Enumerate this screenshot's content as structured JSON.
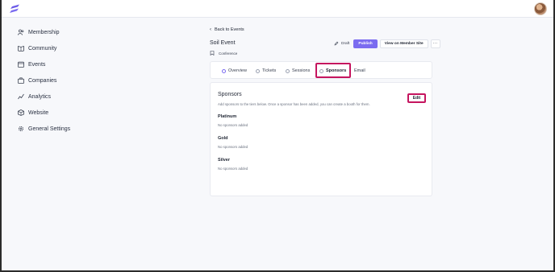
{
  "sidebar": {
    "items": [
      {
        "label": "Membership",
        "icon": "users-icon"
      },
      {
        "label": "Community",
        "icon": "book-icon"
      },
      {
        "label": "Events",
        "icon": "calendar-icon"
      },
      {
        "label": "Companies",
        "icon": "briefcase-icon"
      },
      {
        "label": "Analytics",
        "icon": "chart-line-icon"
      },
      {
        "label": "Website",
        "icon": "cube-icon"
      },
      {
        "label": "General Settings",
        "icon": "gear-icon"
      }
    ]
  },
  "header": {
    "back_label": "Back to Events",
    "event_title": "Soil Event",
    "event_type": "Conference",
    "status": "Draft",
    "publish_label": "Publish",
    "view_label": "View on Member Site",
    "more_label": "···"
  },
  "tabs": [
    {
      "label": "Overview"
    },
    {
      "label": "Tickets"
    },
    {
      "label": "Sessions"
    },
    {
      "label": "Sponsors"
    },
    {
      "label": "Email"
    }
  ],
  "sponsors": {
    "title": "Sponsors",
    "description": "Add sponsors to the tiers below. Once a sponsor has been added, you can create a booth for them.",
    "edit_label": "Edit",
    "tiers": [
      {
        "name": "Platinum",
        "empty": "No sponsors added"
      },
      {
        "name": "Gold",
        "empty": "No sponsors added"
      },
      {
        "name": "Silver",
        "empty": "No sponsors added"
      }
    ]
  },
  "colors": {
    "accent": "#7b6cf0",
    "highlight": "#c5155f"
  }
}
